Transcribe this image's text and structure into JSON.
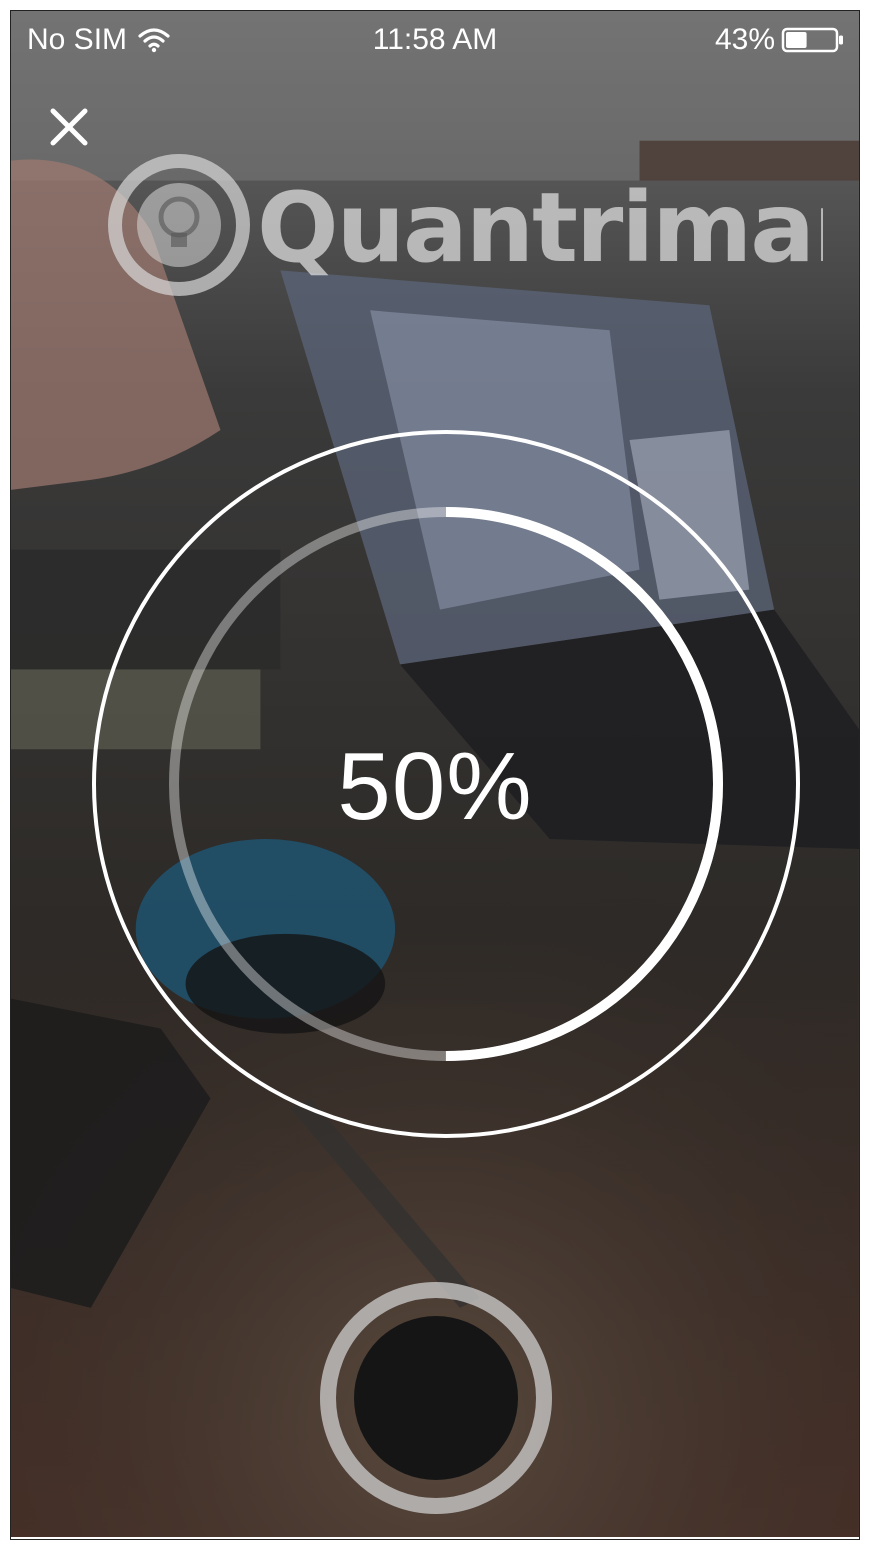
{
  "status_bar": {
    "carrier": "No SIM",
    "time": "11:58 AM",
    "battery": "43%",
    "battery_level": 0.43,
    "wifi_icon": "wifi-icon"
  },
  "close_icon": "close-icon",
  "watermark": "Quantrimang",
  "recording": {
    "progress_text": "50%",
    "progress": 0.5
  },
  "shutter_icon": "record-button",
  "colors": {
    "ring": "#ffffff",
    "shutter_inner": "#151515",
    "shutter_ring": "#cfcfcf"
  }
}
